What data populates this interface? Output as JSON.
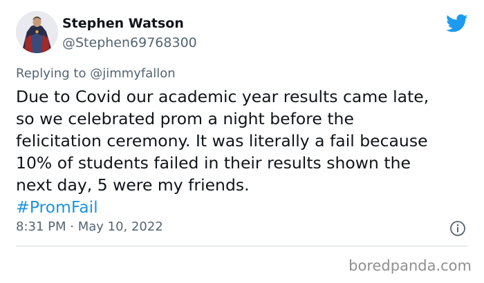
{
  "tweet": {
    "author": {
      "display_name": "Stephen Watson",
      "handle": "@Stephen69768300"
    },
    "replying_to": "Replying to @jimmyfallon",
    "body_lines": [
      "Due to Covid our academic year results came late,",
      "so we celebrated prom a night before the",
      "felicitation ceremony. It was literally a fail because",
      "10% of students failed in their results shown the",
      "next day, 5 were my friends."
    ],
    "hashtag": "#PromFail",
    "timestamp": "8:31 PM · May 10, 2022"
  },
  "icons": {
    "brand": "twitter-bird-icon",
    "info": "info-icon"
  },
  "watermark": "boredpanda.com",
  "colors": {
    "twitter_blue": "#1d9bf0",
    "hashtag_blue": "#1b95e0",
    "secondary_text": "#536471",
    "divider": "#cfd9de",
    "watermark": "#8f8f8f"
  }
}
